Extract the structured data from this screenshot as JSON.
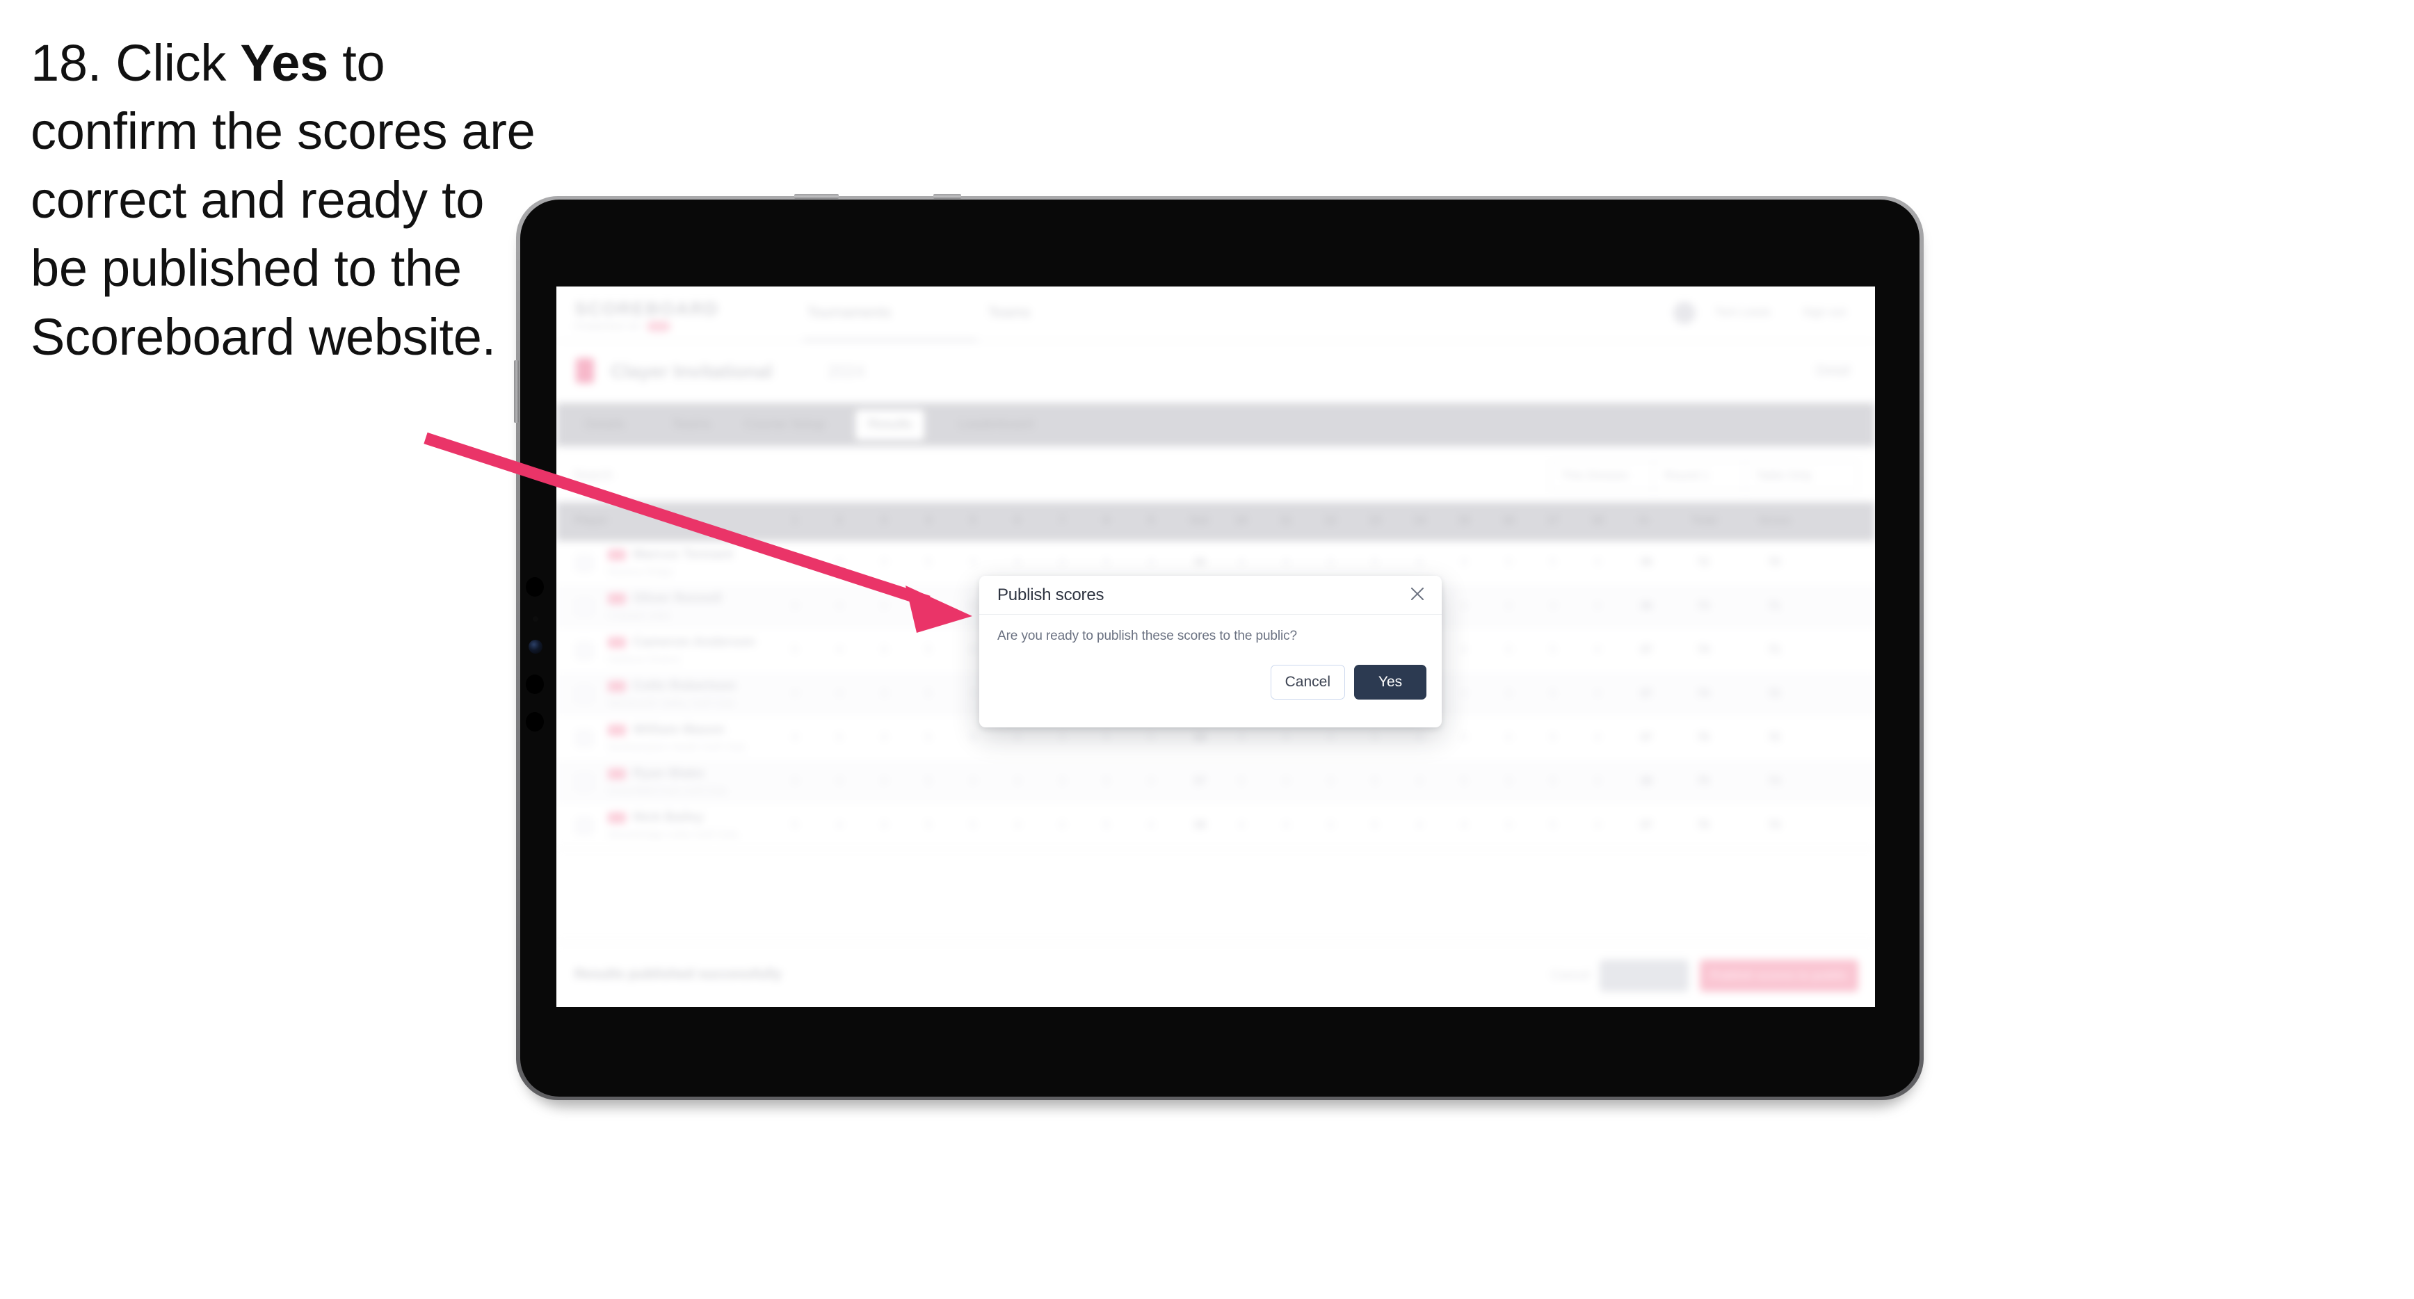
{
  "instruction": {
    "step_number": "18.",
    "text_before": " Click ",
    "emphasis": "Yes",
    "text_after": " to confirm the scores are correct and ready to be published to the Scoreboard website."
  },
  "annotation": {
    "arrow_color": "#ea3468",
    "arrow_name": "pointer-arrow",
    "points_to": "publish-scores-dialog"
  },
  "device": {
    "type": "tablet",
    "bezel_color": "#8e8e90",
    "body_color": "#090909"
  },
  "dialog": {
    "title": "Publish scores",
    "message": "Are you ready to publish these scores to the public?",
    "close_label": "×",
    "cancel_label": "Cancel",
    "confirm_label": "Yes",
    "confirm_color": "#2c3a51",
    "cancel_border_color": "#cdd9ee"
  },
  "app": {
    "header": {
      "wordmark": "SCOREBOARD",
      "sub_label": "POWERED BY",
      "nav": [
        "Tournaments",
        "Teams"
      ],
      "user_name": "Tom Lewis",
      "sign_out": "Sign out"
    },
    "competition": {
      "name": "Clayer Invitational",
      "date": "2024",
      "edit_link": "Detail"
    },
    "tabs": [
      {
        "label": "Details",
        "active": false
      },
      {
        "label": "Teams",
        "active": false
      },
      {
        "label": "Course Setup",
        "active": false
      },
      {
        "label": "Results",
        "active": true
      },
      {
        "label": "Leaderboard",
        "active": false
      }
    ],
    "filters": {
      "search_placeholder": "Search",
      "buttons": [
        "This Division",
        "Round 1",
        "Table Only"
      ]
    },
    "table": {
      "columns": [
        "Player",
        "1",
        "2",
        "3",
        "4",
        "5",
        "6",
        "7",
        "8",
        "9",
        "Out",
        "10",
        "11",
        "12",
        "13",
        "14",
        "15",
        "16",
        "17",
        "18",
        "In",
        "Total",
        "Gross"
      ],
      "rows": [
        {
          "badge": "GBR",
          "name": "Marcus Tennant",
          "club": "Ravens Ridge",
          "scores": [
            "4",
            "4",
            "3",
            "5",
            "4",
            "4",
            "3",
            "5",
            "4",
            "36",
            "4",
            "4",
            "3",
            "5",
            "4",
            "4",
            "3",
            "5",
            "4",
            "36",
            "72",
            "70"
          ]
        },
        {
          "badge": "GBR",
          "name": "Oliver Rennell",
          "club": "Coastal Links",
          "scores": [
            "4",
            "4",
            "4",
            "4",
            "5",
            "4",
            "3",
            "5",
            "4",
            "37",
            "4",
            "4",
            "3",
            "5",
            "4",
            "4",
            "4",
            "4",
            "4",
            "36",
            "73",
            "71"
          ]
        },
        {
          "badge": "GBR",
          "name": "Cameron Anderson",
          "club": "Harbour Downs",
          "scores": [
            "5",
            "4",
            "3",
            "5",
            "4",
            "4",
            "3",
            "5",
            "4",
            "37",
            "4",
            "5",
            "3",
            "5",
            "4",
            "4",
            "3",
            "5",
            "4",
            "37",
            "74",
            "71"
          ]
        },
        {
          "badge": "GBR",
          "name": "Colin Robertson",
          "club": "Wentworth Valley Golf Club",
          "scores": [
            "4",
            "4",
            "3",
            "5",
            "4",
            "4",
            "4",
            "5",
            "4",
            "37",
            "4",
            "4",
            "3",
            "5",
            "5",
            "4",
            "3",
            "5",
            "4",
            "37",
            "74",
            "72"
          ]
        },
        {
          "badge": "GBR",
          "name": "William Mason",
          "club": "Northampton Heath Golf Club",
          "scores": [
            "4",
            "5",
            "3",
            "5",
            "4",
            "4",
            "3",
            "5",
            "5",
            "38",
            "4",
            "4",
            "4",
            "5",
            "4",
            "4",
            "3",
            "5",
            "4",
            "37",
            "75",
            "72"
          ]
        },
        {
          "badge": "GBR",
          "name": "Ryan Blake",
          "club": "Greenfield Park Golf Club",
          "scores": [
            "4",
            "4",
            "4",
            "5",
            "4",
            "4",
            "3",
            "5",
            "4",
            "37",
            "5",
            "4",
            "3",
            "5",
            "4",
            "5",
            "3",
            "5",
            "4",
            "38",
            "75",
            "73"
          ]
        },
        {
          "badge": "GBR",
          "name": "Nick Bailey",
          "club": "Stonebridge Links Golf Club",
          "scores": [
            "5",
            "4",
            "3",
            "5",
            "5",
            "4",
            "3",
            "5",
            "4",
            "38",
            "4",
            "4",
            "3",
            "6",
            "4",
            "4",
            "3",
            "5",
            "4",
            "37",
            "75",
            "73"
          ]
        }
      ]
    },
    "footer": {
      "note": "Results published successfully",
      "discard_label": "Cancel",
      "secondary_label": "Save all",
      "primary_label": "Publish scores to public"
    }
  }
}
